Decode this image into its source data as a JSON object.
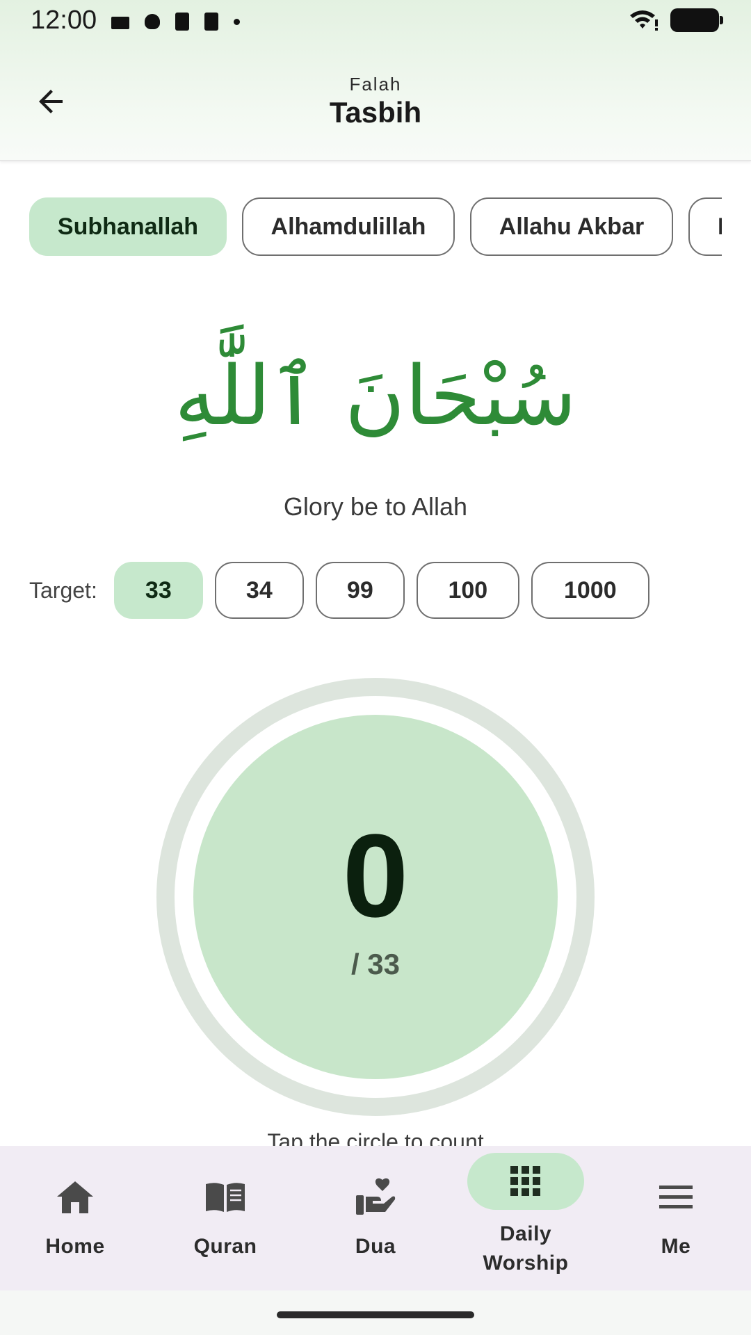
{
  "status_bar": {
    "time": "12:00",
    "left_icons": [
      "card-icon",
      "bug-icon",
      "clipboard-icon",
      "clipboard-icon",
      "dot-icon"
    ],
    "right_icons": [
      "wifi-icon",
      "battery-icon"
    ]
  },
  "header": {
    "app_name": "Falah",
    "title": "Tasbih",
    "back_icon": "arrow-left-icon"
  },
  "dhikr_chips": [
    {
      "label": "Subhanallah",
      "selected": true
    },
    {
      "label": "Alhamdulillah",
      "selected": false
    },
    {
      "label": "Allahu Akbar",
      "selected": false
    },
    {
      "label": "La ilaha illallah",
      "selected": false
    }
  ],
  "dhikr": {
    "arabic": "سُبْحَانَ ٱللَّٰهِ",
    "translation": "Glory be to Allah"
  },
  "target": {
    "label": "Target:",
    "options": [
      "33",
      "34",
      "99",
      "100",
      "1000"
    ],
    "selected": "33"
  },
  "counter": {
    "count": "0",
    "target_text": "/ 33",
    "progress": 0
  },
  "hint": "Tap the circle to count",
  "bottom_nav": [
    {
      "label": "Home",
      "icon": "home-icon",
      "active": false
    },
    {
      "label": "Quran",
      "icon": "book-icon",
      "active": false
    },
    {
      "label": "Dua",
      "icon": "hand-heart-icon",
      "active": false
    },
    {
      "label": "Daily\nWorship",
      "icon": "grid-icon",
      "active": true
    },
    {
      "label": "Me",
      "icon": "menu-icon",
      "active": false
    }
  ],
  "colors": {
    "accent_light": "#c6e8cc",
    "arabic_green": "#2e8b37",
    "nav_background": "#f1ecf4"
  }
}
